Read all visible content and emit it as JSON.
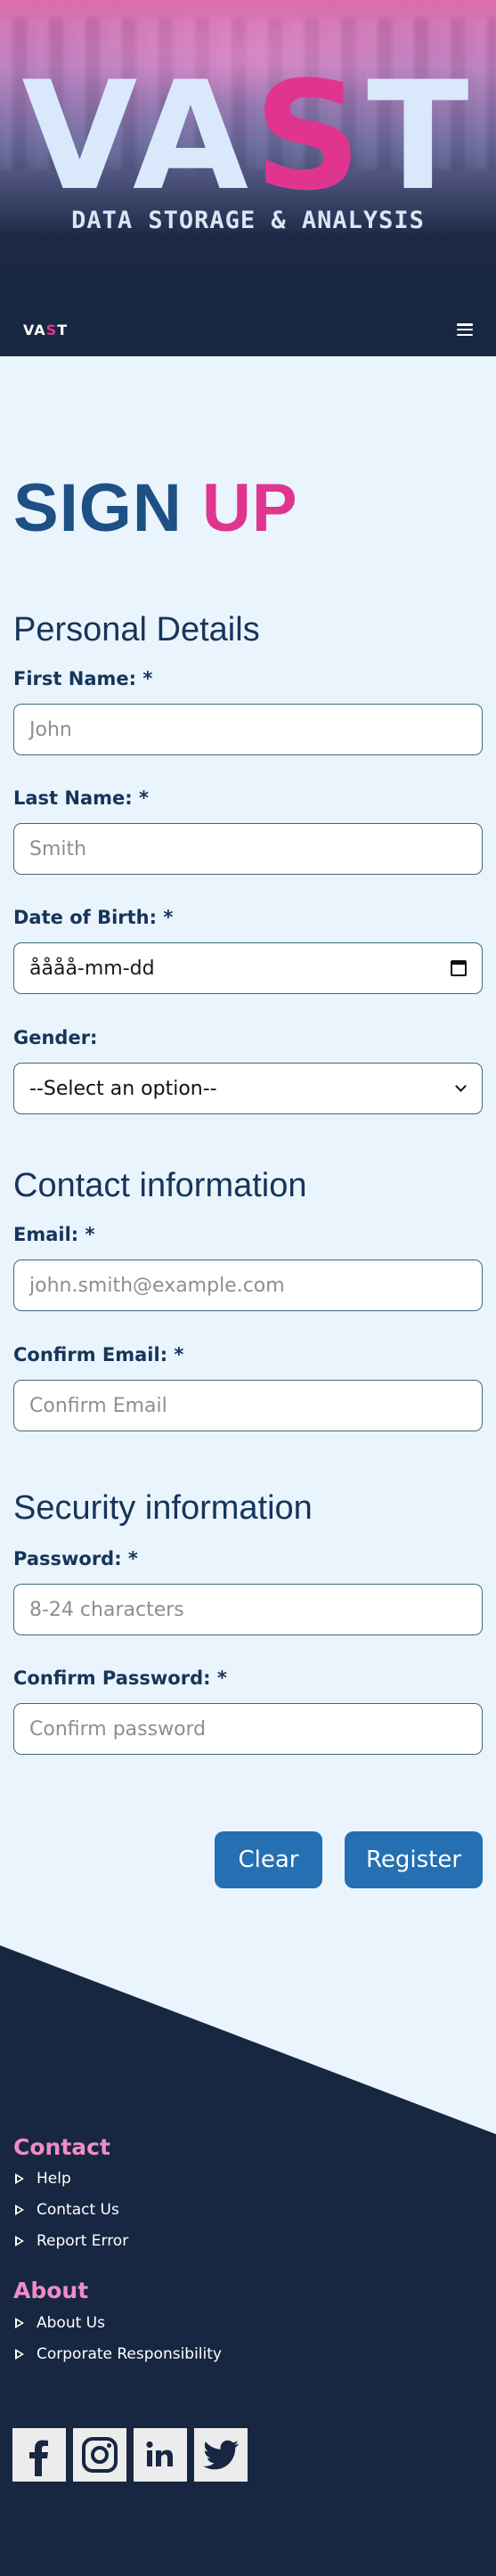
{
  "header": {
    "logo_left": "VA",
    "logo_accent": "S",
    "logo_right": "T",
    "subtitle": "DATA STORAGE & ANALYSIS"
  },
  "nav": {
    "logo_left": "VA",
    "logo_accent": "S",
    "logo_right": "T",
    "menu_icon": "hamburger-menu-icon"
  },
  "form": {
    "title_left": "SIGN",
    "title_accent": "UP",
    "sections": {
      "personal": "Personal Details",
      "contact": "Contact information",
      "security": "Security information"
    },
    "fields": {
      "first_name": {
        "label": "First Name: *",
        "placeholder": "John"
      },
      "last_name": {
        "label": "Last Name: *",
        "placeholder": "Smith"
      },
      "dob": {
        "label": "Date of Birth: *",
        "value": "åååå-mm-dd",
        "icon": "calendar-icon"
      },
      "gender": {
        "label": "Gender:",
        "selected": "--Select an option--"
      },
      "email": {
        "label": "Email: *",
        "placeholder": "john.smith@example.com"
      },
      "confirm_email": {
        "label": "Confirm Email: *",
        "placeholder": "Confirm Email"
      },
      "password": {
        "label": "Password: *",
        "placeholder": "8-24 characters"
      },
      "confirm_password": {
        "label": "Confirm Password: *",
        "placeholder": "Confirm password"
      }
    },
    "buttons": {
      "clear": "Clear",
      "register": "Register"
    }
  },
  "footer": {
    "contact_heading": "Contact",
    "contact_links": [
      "Help",
      "Contact Us",
      "Report Error"
    ],
    "about_heading": "About",
    "about_links": [
      "About Us",
      "Corporate Responsibility"
    ],
    "social": [
      "facebook-icon",
      "instagram-icon",
      "linkedin-icon",
      "twitter-icon"
    ]
  },
  "colors": {
    "accent": "#e0358f",
    "primary": "#2470b3",
    "title_blue": "#1d5185",
    "footer_bg": "#172741",
    "footer_heading": "#f08cc6",
    "page_bg": "#eaf4fd"
  }
}
